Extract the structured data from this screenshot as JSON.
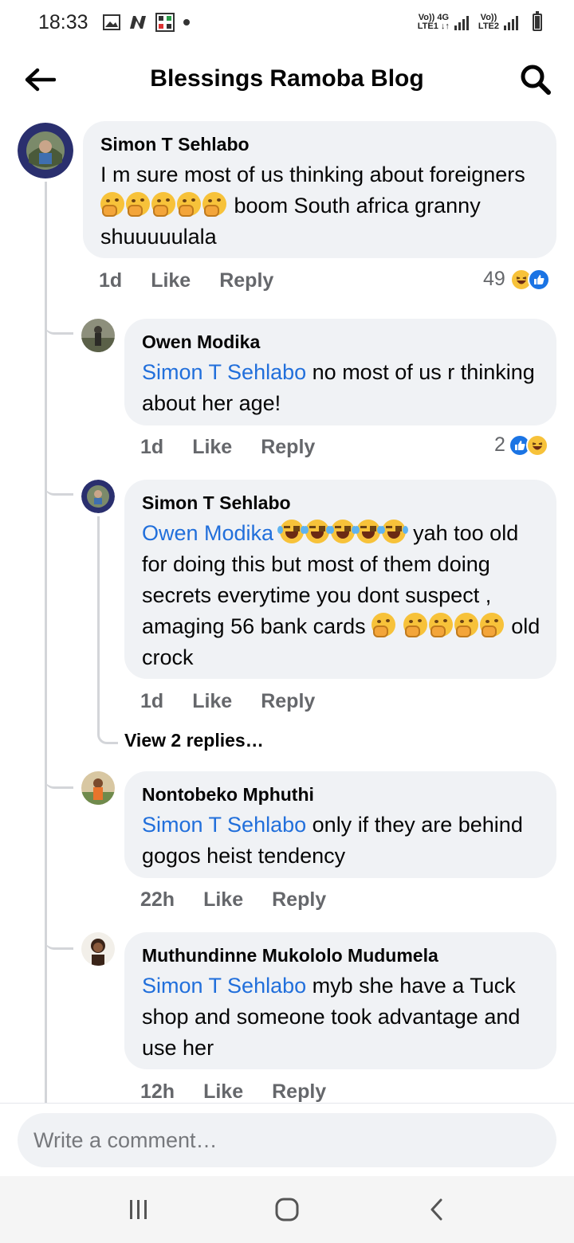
{
  "status_bar": {
    "time": "18:33",
    "net1_label_top": "Vo)) 4G",
    "net1_label_bottom": "LTE1 ↓↑",
    "net2_label_top": "Vo))",
    "net2_label_bottom": "LTE2"
  },
  "header": {
    "title": "Blessings Ramoba Blog"
  },
  "comments": [
    {
      "author": "Simon T Sehlabo",
      "text_before": "I m sure most of us thinking about foreigners",
      "text_after": "boom South africa granny shuuuuulala",
      "time": "1d",
      "like": "Like",
      "reply": "Reply",
      "reaction_count": "49"
    },
    {
      "author": "Owen Modika",
      "mention": "Simon T Sehlabo",
      "text": "no most of us r thinking about her age!",
      "time": "1d",
      "like": "Like",
      "reply": "Reply",
      "reaction_count": "2"
    },
    {
      "author": "Simon T Sehlabo",
      "mention": "Owen Modika",
      "text_a": "yah too old for doing this but most of them doing secrets everytime you dont suspect , amaging 56 bank cards",
      "text_b": "old crock",
      "time": "1d",
      "like": "Like",
      "reply": "Reply"
    },
    {
      "author": "Nontobeko Mphuthi",
      "mention": "Simon T Sehlabo",
      "text": "only if they are behind gogos heist tendency",
      "time": "22h",
      "like": "Like",
      "reply": "Reply"
    },
    {
      "author": "Muthundinne Mukololo Mudumela",
      "mention": "Simon T Sehlabo",
      "text": "myb she have a Tuck shop and someone took advantage and use her",
      "time": "12h",
      "like": "Like",
      "reply": "Reply"
    }
  ],
  "view_replies": "View 2 replies…",
  "composer": {
    "placeholder": "Write a comment…"
  },
  "colors": {
    "mention": "#216fdb",
    "bubble": "#f0f2f5",
    "like_blue": "#1b74e4",
    "haha_yellow": "#f7c23a"
  },
  "icons": [
    "back-arrow-icon",
    "search-icon",
    "gallery-icon",
    "n-app-icon",
    "grid-app-icon",
    "signal-icon",
    "battery-icon",
    "recents-icon",
    "home-icon",
    "nav-back-icon"
  ]
}
